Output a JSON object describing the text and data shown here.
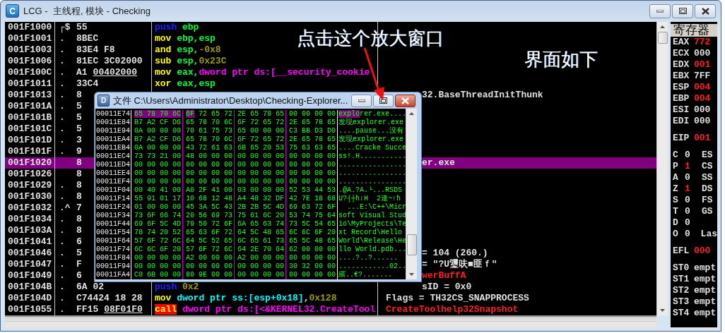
{
  "window": {
    "icon_letter": "C",
    "title": "LCG -  主线程, 模块 - Checking"
  },
  "disassembly": {
    "rows": [
      {
        "address": "001F1000",
        "marker": "┌$",
        "bytes": "55",
        "selected": false,
        "disasm": [
          {
            "kind": "push",
            "text": "push"
          },
          {
            "kind": "operand",
            "text": " ebp"
          }
        ]
      },
      {
        "address": "001F1001",
        "marker": ".",
        "bytes": "8BEC",
        "selected": false,
        "disasm": [
          {
            "kind": "mnemonic",
            "text": "mov"
          },
          {
            "kind": "operand",
            "text": " ebp,esp"
          }
        ]
      },
      {
        "address": "001F1003",
        "marker": ".",
        "bytes": "83E4 F8",
        "selected": false,
        "disasm": [
          {
            "kind": "mnemonic",
            "text": "and"
          },
          {
            "kind": "operand",
            "text": " esp,"
          },
          {
            "kind": "number",
            "text": "-0x8"
          }
        ]
      },
      {
        "address": "001F1006",
        "marker": ".",
        "bytes": "81EC 3C02000",
        "selected": false,
        "disasm": [
          {
            "kind": "mnemonic",
            "text": "sub"
          },
          {
            "kind": "operand",
            "text": " esp,"
          },
          {
            "kind": "number",
            "text": "0x23C"
          }
        ]
      },
      {
        "address": "001F100C",
        "marker": ".",
        "bytes": "A1",
        "ref": "00402000",
        "selected": false,
        "disasm": [
          {
            "kind": "mnemonic",
            "text": "mov"
          },
          {
            "kind": "operand",
            "text": " eax,"
          },
          {
            "kind": "memory",
            "text": "dword ptr ds:[__security_cookie"
          }
        ]
      },
      {
        "address": "001F1011",
        "marker": ".",
        "bytes": "33C4",
        "selected": false,
        "disasm": [
          {
            "kind": "mnemonic",
            "text": "xor"
          },
          {
            "kind": "operand",
            "text": " eax,esp"
          }
        ]
      },
      {
        "address": "001F1013",
        "marker": ".",
        "bytes": "8",
        "selected": false,
        "comment": {
          "text": "32.BaseThreadInitThunk",
          "kind": "plain",
          "behind_window": true
        }
      },
      {
        "address": "001F101A",
        "marker": ".",
        "bytes": "5",
        "selected": false
      },
      {
        "address": "001F101B",
        "marker": ".",
        "bytes": "5",
        "selected": false
      },
      {
        "address": "001F101C",
        "marker": ".",
        "bytes": "5",
        "selected": false
      },
      {
        "address": "001F101D",
        "marker": ".",
        "bytes": "3",
        "selected": false
      },
      {
        "address": "001F101F",
        "marker": ".",
        "bytes": "9",
        "selected": false
      },
      {
        "address": "001F1020",
        "bytes": "8",
        "selected": true,
        "comment": {
          "text": "er.exe",
          "kind": "plain",
          "behind_window": true
        }
      },
      {
        "address": "001F1026",
        "bytes": "8",
        "selected": false
      },
      {
        "address": "001F1029",
        "marker": ".",
        "bytes": "8",
        "selected": false
      },
      {
        "address": "001F1030",
        "marker": ".",
        "bytes": "8",
        "selected": false
      },
      {
        "address": "001F1032",
        "marker": ".^",
        "bytes": "7",
        "selected": false
      },
      {
        "address": "001F1034",
        "marker": ".",
        "bytes": "8",
        "selected": false
      },
      {
        "address": "001F103A",
        "marker": ".",
        "bytes": "8",
        "selected": false
      },
      {
        "address": "001F1041",
        "marker": ".",
        "bytes": "6",
        "selected": false
      },
      {
        "address": "001F1046",
        "marker": ".",
        "bytes": "5",
        "selected": false,
        "comment": {
          "text": "= 104 (260.)",
          "kind": "plain",
          "behind_window": true
        }
      },
      {
        "address": "001F1047",
        "marker": ".",
        "bytes": "F",
        "selected": false,
        "comment": {
          "text": "= \"?U瓕呋■匪ｆ\"",
          "kind": "plain",
          "behind_window": true
        }
      },
      {
        "address": "001F1049",
        "marker": ".",
        "bytes": "6",
        "selected": false,
        "comment": {
          "text": "werBuffA",
          "kind": "api",
          "behind_window": true
        }
      },
      {
        "address": "001F104B",
        "marker": ".",
        "bytes": "6A 02",
        "selected": false,
        "disasm": [
          {
            "kind": "push",
            "text": "push"
          },
          {
            "kind": "number",
            "text": " 0x2"
          }
        ],
        "comment": {
          "text": "sID = 0x0",
          "kind": "plain",
          "behind_window": true
        }
      },
      {
        "address": "001F104D",
        "marker": ".",
        "bytes": "C74424 18 28",
        "selected": false,
        "disasm": [
          {
            "kind": "mnemonic",
            "text": "mov"
          },
          {
            "kind": "stack-memory",
            "text": " dword ptr ss:[esp+0x18]"
          },
          {
            "kind": "punct",
            "text": ","
          },
          {
            "kind": "number",
            "text": "0x128"
          }
        ],
        "comment": {
          "text": "Flags = TH32CS_SNAPPROCESS",
          "kind": "plain",
          "behind_window": false
        }
      },
      {
        "address": "001F1055",
        "marker": ".",
        "bytes": "FF15",
        "ref": "08F01F0",
        "selected": false,
        "disasm": [
          {
            "kind": "call",
            "text": "call"
          },
          {
            "kind": "memory",
            "text": " dword ptr ds:[<&KERNEL32.CreateTool"
          }
        ],
        "comment": {
          "text": "CreateToolhelp32Snapshot",
          "kind": "api",
          "behind_window": false
        }
      }
    ]
  },
  "registers": {
    "title": "寄存器",
    "groups": [
      [
        {
          "name": "EAX",
          "value": "772",
          "changed": true
        },
        {
          "name": "ECX",
          "value": "000",
          "changed": false
        },
        {
          "name": "EDX",
          "value": "001",
          "changed": true
        },
        {
          "name": "EBX",
          "value": "7FF",
          "changed": false
        },
        {
          "name": "ESP",
          "value": "004",
          "changed": true
        },
        {
          "name": "EBP",
          "value": "004",
          "changed": true
        },
        {
          "name": "ESI",
          "value": "000",
          "changed": false
        },
        {
          "name": "EDI",
          "value": "000",
          "changed": false
        }
      ],
      [
        {
          "name": "EIP",
          "value": "001",
          "changed": true
        }
      ],
      [
        {
          "kind": "flag",
          "name": "C",
          "value": "0",
          "changed": false,
          "segment": "ES"
        },
        {
          "kind": "flag",
          "name": "P",
          "value": "1",
          "changed": true,
          "segment": "CS"
        },
        {
          "kind": "flag",
          "name": "A",
          "value": "0",
          "changed": false,
          "segment": "SS"
        },
        {
          "kind": "flag",
          "name": "Z",
          "value": "1",
          "changed": true,
          "segment": "DS"
        },
        {
          "kind": "flag",
          "name": "S",
          "value": "0",
          "changed": false,
          "segment": "FS"
        },
        {
          "kind": "flag",
          "name": "T",
          "value": "0",
          "changed": false,
          "segment": "GS"
        },
        {
          "kind": "flag",
          "name": "D",
          "value": "0",
          "changed": false
        },
        {
          "kind": "flag",
          "name": "O",
          "value": "0",
          "changed": false,
          "segment": "Las"
        }
      ],
      [
        {
          "name": "EFL",
          "value": "000",
          "changed": true
        }
      ],
      [
        {
          "name": "ST0",
          "value": "empt",
          "changed": false
        },
        {
          "name": "ST1",
          "value": "empt",
          "changed": false
        },
        {
          "name": "ST2",
          "value": "empt",
          "changed": false
        },
        {
          "name": "ST3",
          "value": "empt",
          "changed": false
        },
        {
          "name": "ST4",
          "value": "empt",
          "changed": false
        }
      ]
    ]
  },
  "dump_window": {
    "icon_letter": "D",
    "title": "文件 C:\\Users\\Administrator\\Desktop\\Checking-Explorer...",
    "rows": [
      {
        "address": "00011E74",
        "groups": [
          [
            {
              "text": "65 78 70 6C",
              "selected": true
            }
          ],
          [
            {
              "text": "6F",
              "selected": true
            },
            {
              "text": " 72 65 72",
              "selected": false
            }
          ],
          "2E 65 78 65",
          "00 00 00 00"
        ],
        "ascii": [
          {
            "text": "explo",
            "selected": true
          },
          {
            "text": "rer.exe....",
            "selected": false
          }
        ]
      },
      {
        "address": "00011E84",
        "groups": [
          "B7 A2 CF D6",
          "65 78 70 6C",
          "6F 72 65 72",
          "2E 65 78 65"
        ],
        "ascii": "发现explorer.exe"
      },
      {
        "address": "00011E94",
        "groups": [
          "0A 00 00 00",
          "70 61 75 73",
          "65 00 00 00",
          "C3 BB D3 D0"
        ],
        "ascii": "....pause...没有"
      },
      {
        "address": "00011EA4",
        "groups": [
          "B7 A2 CF D6",
          "65 78 70 6C",
          "6F 72 65 72",
          "2E 65 78 65"
        ],
        "ascii": "发现explorer.exe"
      },
      {
        "address": "00011EB4",
        "groups": [
          "0A 00 00 00",
          "43 72 61 63",
          "6B 65 20 53",
          "75 63 63 65"
        ],
        "ascii": "....Cracke Succe"
      },
      {
        "address": "00011EC4",
        "groups": [
          "73 73 21 00",
          "48 00 00 00",
          "00 00 00 00",
          "00 00 00 00"
        ],
        "ascii": "ss!.H..........."
      },
      {
        "address": "00011ED4",
        "groups": [
          "00 00 00 00",
          "00 00 00 00",
          "00 00 00 00",
          "00 00 00 00"
        ],
        "ascii": "................"
      },
      {
        "address": "00011EE4",
        "groups": [
          "00 00 00 00",
          "00 00 00 00",
          "00 00 00 00",
          "00 00 00 00"
        ],
        "ascii": "................"
      },
      {
        "address": "00011EF4",
        "groups": [
          "00 00 00 00",
          "00 00 00 00",
          "00 00 00 00",
          "00 00 00 00"
        ],
        "ascii": "................"
      },
      {
        "address": "00011F04",
        "groups": [
          "00 40 41 00",
          "A0 2F 41 00",
          "03 00 00 00",
          "52 53 44 53"
        ],
        "ascii": ".@A.?A.└...RSDS"
      },
      {
        "address": "00011F14",
        "groups": [
          "55 91 01 17",
          "10 68 12 48",
          "A4 48 32 DF",
          "42 7E 18 68"
        ],
        "ascii": "U?┤┼h↕H  2連~↑h"
      },
      {
        "address": "00011F24",
        "groups": [
          "01 00 00 00",
          "45 3A 5C 43",
          "2B 2B 5C 4D",
          "69 63 72 6F"
        ],
        "ascii": "  ...E:\\C++\\Micr"
      },
      {
        "address": "00011F34",
        "groups": [
          "73 6F 66 74",
          "20 56 69 73",
          "75 61 6C 20",
          "53 74 75 64"
        ],
        "ascii": "soft Visual Stud"
      },
      {
        "address": "00011F44",
        "groups": [
          "69 6F 5C 4D",
          "79 50 72 6F",
          "6A 65 63 74",
          "73 5C 54 65"
        ],
        "ascii": "io\\MyProjects\\Te"
      },
      {
        "address": "00011F54",
        "groups": [
          "78 74 20 52",
          "65 63 6F 72",
          "64 5C 48 65",
          "6C 6C 6F 20"
        ],
        "ascii": "xt Record\\Hello"
      },
      {
        "address": "00011F64",
        "groups": [
          "57 6F 72 6C",
          "64 5C 52 65",
          "6C 65 61 73",
          "65 5C 48 65"
        ],
        "ascii": "World\\Release\\He"
      },
      {
        "address": "00011F74",
        "groups": [
          "6C 6C 6F 20",
          "57 6F 72 6C",
          "64 2E 70 64",
          "62 00 00 00"
        ],
        "ascii": "llo World.pdb..."
      },
      {
        "address": "00011F84",
        "groups": [
          "00 00 00 00",
          "A2 00 00 00",
          "A2 00 00 00",
          "00 00 00 00"
        ],
        "ascii": "....?..?......"
      },
      {
        "address": "00011F94",
        "groups": [
          "00 00 00 00",
          "00 00 00 00",
          "00 00 00 00",
          "30 32 00 00"
        ],
        "ascii": "............02.."
      },
      {
        "address": "00011FA4",
        "groups": [
          "C0 6B 00 00",
          "80 9E 00 00",
          "00 00 00 00",
          "00 00 00 00"
        ],
        "ascii": "繽..€?......."
      }
    ]
  },
  "annotations": [
    {
      "text": "点击这个放大窗口"
    },
    {
      "text": "界面如下"
    }
  ]
}
